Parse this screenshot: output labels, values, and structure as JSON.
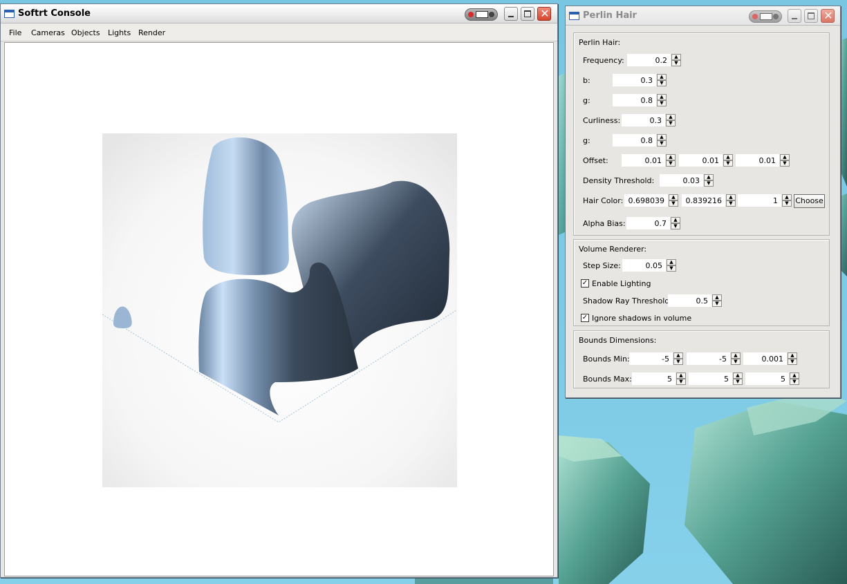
{
  "console": {
    "title": "Softrt Console",
    "menu": [
      "File",
      "Cameras",
      "Objects",
      "Lights",
      "Render"
    ]
  },
  "panel": {
    "title": "Perlin Hair",
    "perlin": {
      "heading": "Perlin Hair:",
      "frequency_label": "Frequency:",
      "frequency": "0.2",
      "b_label": "b:",
      "b": "0.3",
      "g_label": "g:",
      "g": "0.8",
      "curliness_label": "Curliness:",
      "curliness": "0.3",
      "g2_label": "g:",
      "g2": "0.8",
      "offset_label": "Offset:",
      "offset": [
        "0.01",
        "0.01",
        "0.01"
      ],
      "density_label": "Density Threshold:",
      "density": "0.03",
      "hair_color_label": "Hair Color:",
      "hair_color": [
        "0.698039",
        "0.839216",
        "1"
      ],
      "choose_label": "Choose",
      "alpha_bias_label": "Alpha Bias:",
      "alpha_bias": "0.7"
    },
    "volume": {
      "heading": "Volume Renderer:",
      "step_size_label": "Step Size:",
      "step_size": "0.05",
      "enable_lighting_label": "Enable Lighting",
      "enable_lighting": true,
      "shadow_label": "Shadow Ray Threshold:",
      "shadow": "0.5",
      "ignore_shadows_label": "Ignore shadows in volume",
      "ignore_shadows": true
    },
    "bounds": {
      "heading": "Bounds Dimensions:",
      "min_label": "Bounds Min:",
      "min": [
        "-5",
        "-5",
        "0.001"
      ],
      "max_label": "Bounds Max:",
      "max": [
        "5",
        "5",
        "5"
      ]
    }
  },
  "colors": {
    "render_blob": "#b2d6ff",
    "desktop": "#7cc8e3",
    "close_button": "#d5452d"
  },
  "icons": [
    "app-icon",
    "minimize-icon",
    "maximize-icon",
    "close-icon",
    "spin-up-icon",
    "spin-down-icon",
    "checkmark-icon"
  ]
}
